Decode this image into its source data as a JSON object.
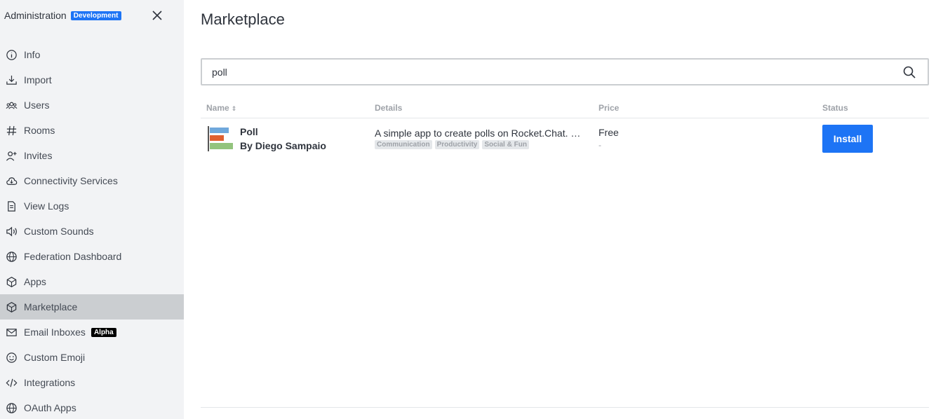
{
  "sidebar": {
    "title": "Administration",
    "badge": "Development",
    "items": [
      {
        "label": "Info",
        "icon": "info-icon"
      },
      {
        "label": "Import",
        "icon": "import-icon"
      },
      {
        "label": "Users",
        "icon": "users-icon"
      },
      {
        "label": "Rooms",
        "icon": "hash-icon"
      },
      {
        "label": "Invites",
        "icon": "user-plus-icon"
      },
      {
        "label": "Connectivity Services",
        "icon": "cloud-icon"
      },
      {
        "label": "View Logs",
        "icon": "document-icon"
      },
      {
        "label": "Custom Sounds",
        "icon": "sound-icon"
      },
      {
        "label": "Federation Dashboard",
        "icon": "globe-icon"
      },
      {
        "label": "Apps",
        "icon": "cube-icon"
      },
      {
        "label": "Marketplace",
        "icon": "cube-icon",
        "active": true
      },
      {
        "label": "Email Inboxes",
        "icon": "mail-icon",
        "badge": "Alpha"
      },
      {
        "label": "Custom Emoji",
        "icon": "emoji-icon"
      },
      {
        "label": "Integrations",
        "icon": "code-icon"
      },
      {
        "label": "OAuth Apps",
        "icon": "globe-icon"
      }
    ]
  },
  "main": {
    "title": "Marketplace",
    "search": {
      "value": "poll",
      "placeholder": ""
    },
    "table": {
      "headers": {
        "name": "Name",
        "details": "Details",
        "price": "Price",
        "status": "Status"
      },
      "rows": [
        {
          "name": "Poll",
          "author": "By Diego Sampaio",
          "description": "A simple app to create polls on Rocket.Chat. Just use the /poll command",
          "tags": [
            "Communication",
            "Productivity",
            "Social & Fun"
          ],
          "price": "Free",
          "price_sub": "-",
          "action": "Install"
        }
      ]
    }
  },
  "colors": {
    "accent": "#1d74f5",
    "sidebar_bg": "#f2f3f5",
    "active_bg": "#cbced1"
  }
}
